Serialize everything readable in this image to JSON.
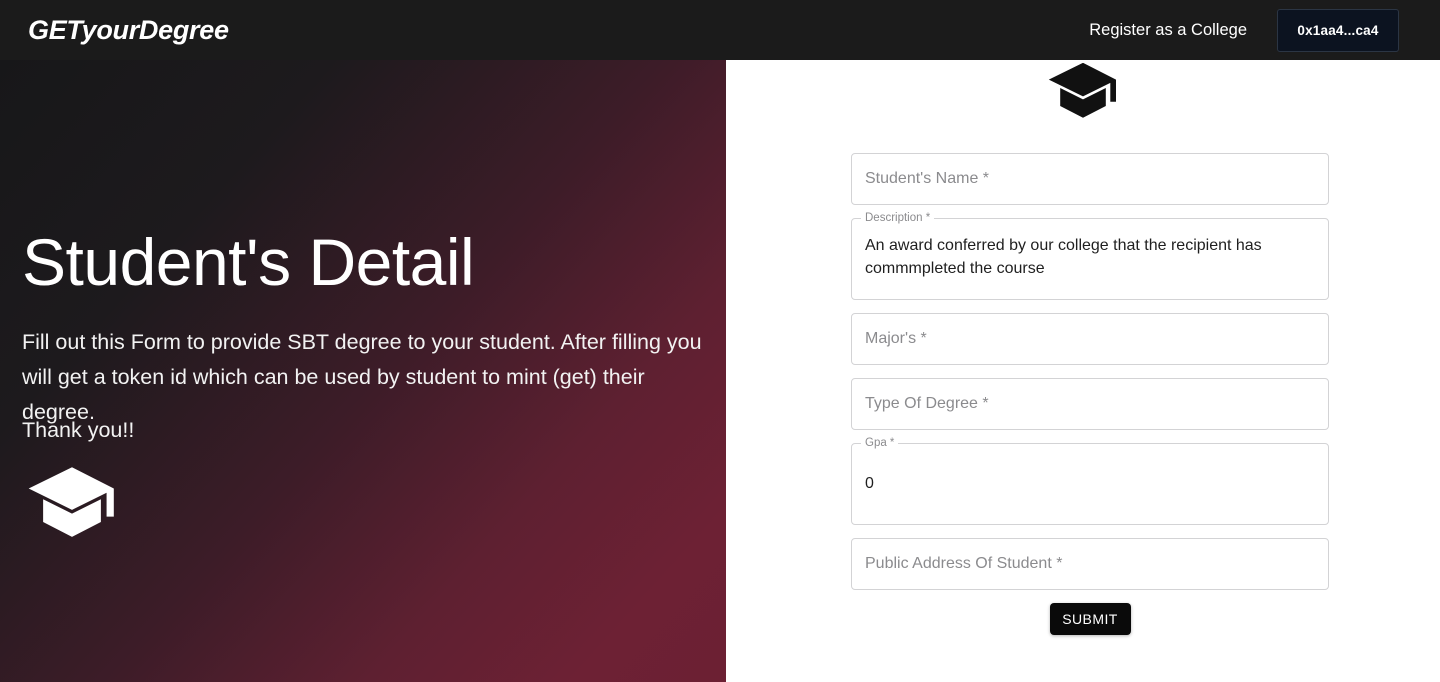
{
  "header": {
    "brand": "GETyourDegree",
    "register_link": "Register as a College",
    "wallet_button": "0x1aa4...ca4"
  },
  "hero": {
    "title": "Student's Detail",
    "body": "Fill out this Form to provide SBT degree to your student. After filling you will get a token id which can be used by student to mint (get) their degree.",
    "thanks": "Thank you!!",
    "icon": "graduation-cap-icon"
  },
  "form": {
    "icon": "graduation-cap-icon",
    "fields": [
      {
        "name": "students-name",
        "label": "Student's Name *",
        "placeholder": "Student's Name *",
        "value": "",
        "filled": false,
        "multiline": false
      },
      {
        "name": "description",
        "label": "Description *",
        "placeholder": "Description *",
        "value": "An award conferred by our college that the recipient has commmpleted the course",
        "filled": true,
        "multiline": true
      },
      {
        "name": "majors",
        "label": "Major's *",
        "placeholder": "Major's *",
        "value": "",
        "filled": false,
        "multiline": false
      },
      {
        "name": "type-of-degree",
        "label": "Type Of Degree *",
        "placeholder": "Type Of Degree *",
        "value": "",
        "filled": false,
        "multiline": false
      },
      {
        "name": "gpa",
        "label": "Gpa *",
        "placeholder": "Gpa *",
        "value": "0",
        "filled": true,
        "multiline": false
      },
      {
        "name": "public-address-of-student",
        "label": "Public Address Of Student *",
        "placeholder": "Public Address Of Student *",
        "value": "",
        "filled": false,
        "multiline": false
      }
    ],
    "submit_label": "SUBMIT"
  },
  "colors": {
    "header_bg": "#1b1b1b",
    "panel_gradient_start": "#171719",
    "panel_gradient_end": "#6c2033",
    "wallet_bg": "#0c1320",
    "submit_bg": "#0a0a0a",
    "field_border": "#d3d3d5",
    "placeholder_text": "#8b8b8e"
  }
}
